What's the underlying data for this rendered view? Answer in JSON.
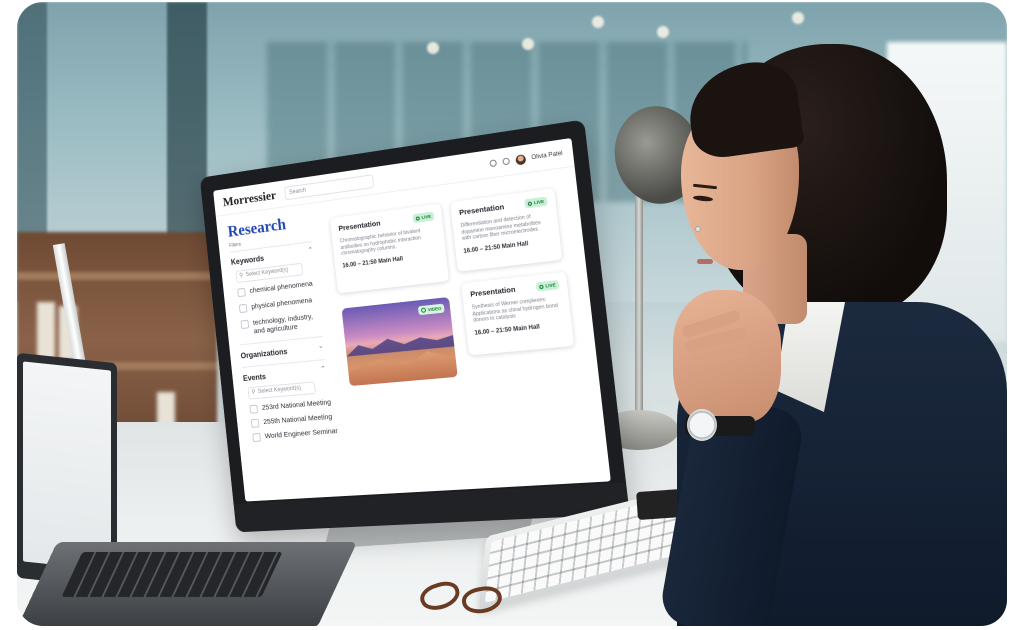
{
  "app": {
    "logo": "Morressier",
    "search_placeholder": "Search",
    "user_name": "Olivia Patel"
  },
  "sidebar": {
    "title": "Research",
    "filters_label": "Filters",
    "groups": {
      "keywords": {
        "title": "Keywords",
        "search_placeholder": "Select Keyword(s)",
        "items": [
          "chemical phenomena",
          "physical phenomena",
          "technology, industry, and agriculture"
        ]
      },
      "organizations": {
        "title": "Organizations"
      },
      "events": {
        "title": "Events",
        "search_placeholder": "Select Keyword(s)",
        "items": [
          "253rd National Meeting",
          "255th National Meeting",
          "World Engineer Seminar"
        ]
      }
    }
  },
  "cards": [
    {
      "type": "Presentation",
      "badge": "LIVE",
      "description": "Chromatographic behavior of bivalent antibodies on hydrophobic interaction chromatography columns.",
      "time": "16.00 – 21:50 Main Hall"
    },
    {
      "type": "Presentation",
      "badge": "LIVE",
      "description": "Differentiation and detection of dopamine monoamine metabolites with carbon fiber microelectrodes",
      "time": "16.00 – 21:50 Main Hall"
    },
    {
      "type": "Presentation",
      "badge": "LIVE",
      "description": "Synthesis of Werner complexes: Applications as chiral hydrogen bond donors in catalysis",
      "time": "16.00 – 21:50 Main Hall"
    }
  ],
  "video_card": {
    "badge": "VIDEO",
    "icon": "play-circle-icon"
  },
  "colors": {
    "brand_blue": "#2147b4",
    "live_badge_bg": "#c9f1d6",
    "live_badge_text": "#167a3a"
  }
}
